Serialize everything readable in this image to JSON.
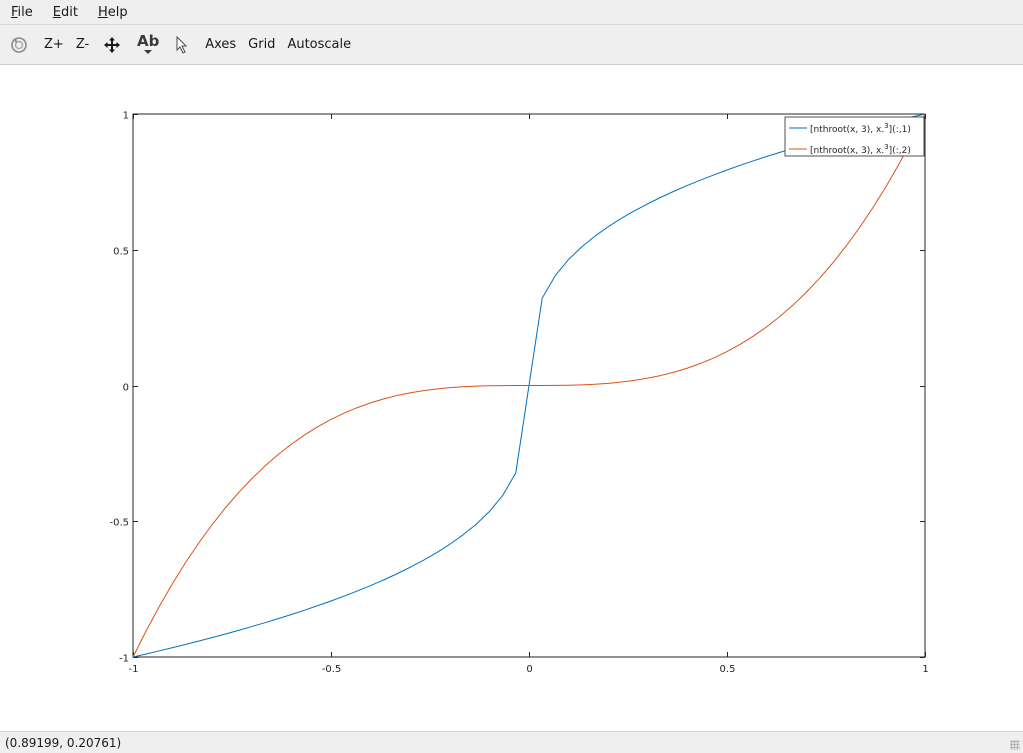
{
  "menu": {
    "items": [
      {
        "accel": "F",
        "rest": "ile"
      },
      {
        "accel": "E",
        "rest": "dit"
      },
      {
        "accel": "H",
        "rest": "elp"
      }
    ]
  },
  "toolbar": {
    "rotate_icon": "rotate-icon",
    "zoom_in_label": "Z+",
    "zoom_out_label": "Z-",
    "pan_icon": "move-arrows-icon",
    "text_tool_label": "Ab",
    "select_icon": "pointer-arrow-icon",
    "axes_label": "Axes",
    "grid_label": "Grid",
    "autoscale_label": "Autoscale"
  },
  "status": {
    "coords": "(0.89199, 0.20761)"
  },
  "chart_data": {
    "type": "line",
    "title": "",
    "xlabel": "",
    "ylabel": "",
    "xlim": [
      -1,
      1
    ],
    "ylim": [
      -1,
      1
    ],
    "grid": false,
    "legend_position": "top-right",
    "x_ticks": [
      "-1",
      "-0.5",
      "0",
      "0.5",
      "1"
    ],
    "y_ticks": [
      "-1",
      "-0.5",
      "0",
      "0.5",
      "1"
    ],
    "x_tick_values": [
      -1,
      -0.5,
      0,
      0.5,
      1
    ],
    "y_tick_values": [
      -1,
      -0.5,
      0,
      0.5,
      1
    ],
    "x": [
      -1,
      -0.9667,
      -0.9333,
      -0.9,
      -0.8667,
      -0.8333,
      -0.8,
      -0.7667,
      -0.7333,
      -0.7,
      -0.6667,
      -0.6333,
      -0.6,
      -0.5667,
      -0.5333,
      -0.5,
      -0.4667,
      -0.4333,
      -0.4,
      -0.3667,
      -0.3333,
      -0.3,
      -0.2667,
      -0.2333,
      -0.2,
      -0.1667,
      -0.1333,
      -0.1,
      -0.0667,
      -0.0333,
      0,
      0.0333,
      0.0667,
      0.1,
      0.1333,
      0.1667,
      0.2,
      0.2333,
      0.2667,
      0.3,
      0.3333,
      0.3667,
      0.4,
      0.4333,
      0.4667,
      0.5,
      0.5333,
      0.5667,
      0.6,
      0.6333,
      0.6667,
      0.7,
      0.7333,
      0.7667,
      0.8,
      0.8333,
      0.8667,
      0.9,
      0.9333,
      0.9667,
      1
    ],
    "series": [
      {
        "name_main": "[nthroot(x, 3), x.",
        "name_sup": "3",
        "name_tail": "](:,1)",
        "color": "#0072bd",
        "values": [
          -1,
          -0.9888,
          -0.9772,
          -0.9655,
          -0.9535,
          -0.941,
          -0.9283,
          -0.9154,
          -0.9018,
          -0.8879,
          -0.8736,
          -0.8587,
          -0.8434,
          -0.8275,
          -0.8109,
          -0.7937,
          -0.7756,
          -0.7566,
          -0.7368,
          -0.7159,
          -0.6934,
          -0.6694,
          -0.6437,
          -0.6157,
          -0.5848,
          -0.5503,
          -0.5109,
          -0.4642,
          -0.4055,
          -0.3218,
          0,
          0.3218,
          0.4055,
          0.4642,
          0.5109,
          0.5503,
          0.5848,
          0.6157,
          0.6437,
          0.6694,
          0.6934,
          0.7159,
          0.7368,
          0.7566,
          0.7756,
          0.7937,
          0.8109,
          0.8275,
          0.8434,
          0.8587,
          0.8736,
          0.8879,
          0.9018,
          0.9154,
          0.9283,
          0.941,
          0.9535,
          0.9655,
          0.9772,
          0.9888,
          1
        ]
      },
      {
        "name_main": "[nthroot(x, 3), x.",
        "name_sup": "3",
        "name_tail": "](:,2)",
        "color": "#d95319",
        "values": [
          -1,
          -0.9034,
          -0.813,
          -0.729,
          -0.651,
          -0.5787,
          -0.512,
          -0.4507,
          -0.3944,
          -0.343,
          -0.2963,
          -0.254,
          -0.216,
          -0.182,
          -0.1517,
          -0.125,
          -0.1016,
          -0.0814,
          -0.064,
          -0.0493,
          -0.037,
          -0.027,
          -0.019,
          -0.0127,
          -0.008,
          -0.0046,
          -0.0024,
          -0.001,
          -0.0003,
          0,
          0,
          0,
          0.0003,
          0.001,
          0.0024,
          0.0046,
          0.008,
          0.0127,
          0.019,
          0.027,
          0.037,
          0.0493,
          0.064,
          0.0814,
          0.1016,
          0.125,
          0.1517,
          0.182,
          0.216,
          0.254,
          0.2963,
          0.343,
          0.3944,
          0.4507,
          0.512,
          0.5787,
          0.651,
          0.729,
          0.813,
          0.9034,
          1
        ]
      }
    ]
  }
}
